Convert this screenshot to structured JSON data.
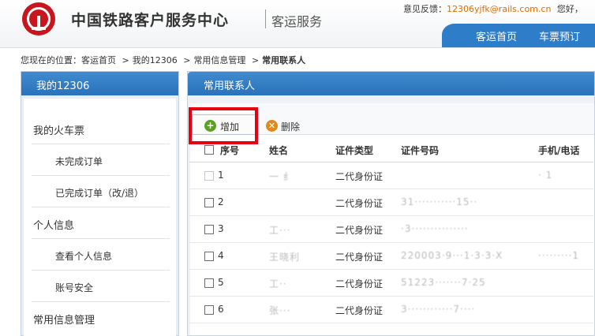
{
  "header": {
    "site_title": "中国铁路客户服务中心",
    "site_subtitle": "客运服务",
    "feedback_label": "意见反馈：",
    "feedback_email": "12306yjfk@rails.com.cn",
    "greeting": "您好，",
    "nav": [
      "客运首页",
      "车票预订"
    ]
  },
  "breadcrumb": {
    "prefix": "您现在的位置：",
    "items": [
      "客运首页",
      "我的12306",
      "常用信息管理",
      "常用联系人"
    ],
    "separator": ">"
  },
  "sidebar": {
    "title": "我的12306",
    "items": [
      {
        "label": "我的火车票",
        "level": "section"
      },
      {
        "label": "未完成订单",
        "level": "sub"
      },
      {
        "label": "已完成订单（改/退）",
        "level": "sub"
      },
      {
        "label": "个人信息",
        "level": "section"
      },
      {
        "label": "查看个人信息",
        "level": "sub"
      },
      {
        "label": "账号安全",
        "level": "sub"
      },
      {
        "label": "常用信息管理",
        "level": "section"
      }
    ]
  },
  "panel": {
    "title": "常用联系人",
    "toolbar": {
      "add_label": "增加",
      "add_icon": "plus-circle-icon",
      "delete_label": "删除",
      "delete_icon": "x-circle-icon",
      "highlight_color": "#e60012"
    },
    "table": {
      "columns": [
        "序号",
        "姓名",
        "证件类型",
        "证件号码",
        "手机/电话"
      ],
      "rows": [
        {
          "index": "1",
          "name": "一 纟",
          "id_type": "二代身份证",
          "id_number": "",
          "phone": "·                1"
        },
        {
          "index": "2",
          "name": "",
          "id_type": "二代身份证",
          "id_number": "31···········15··",
          "phone": ""
        },
        {
          "index": "3",
          "name": "工···",
          "id_type": "二代身份证",
          "id_number": "·3···············",
          "phone": ""
        },
        {
          "index": "4",
          "name": "王晓利",
          "id_type": "二代身份证",
          "id_number": "220003·9···1·3·3·X",
          "phone": "·········1"
        },
        {
          "index": "5",
          "name": "工··",
          "id_type": "二代身份证",
          "id_number": "51223·······7·25",
          "phone": ""
        },
        {
          "index": "6",
          "name": "张···",
          "id_type": "二代身份证",
          "id_number": "3············7····",
          "phone": ""
        }
      ]
    }
  },
  "colors": {
    "brand_red": "#c8161e",
    "nav_blue": "#2d7dc8",
    "email_orange": "#e06b00",
    "add_green": "#5aa31e",
    "delete_orange": "#e08a1c"
  }
}
